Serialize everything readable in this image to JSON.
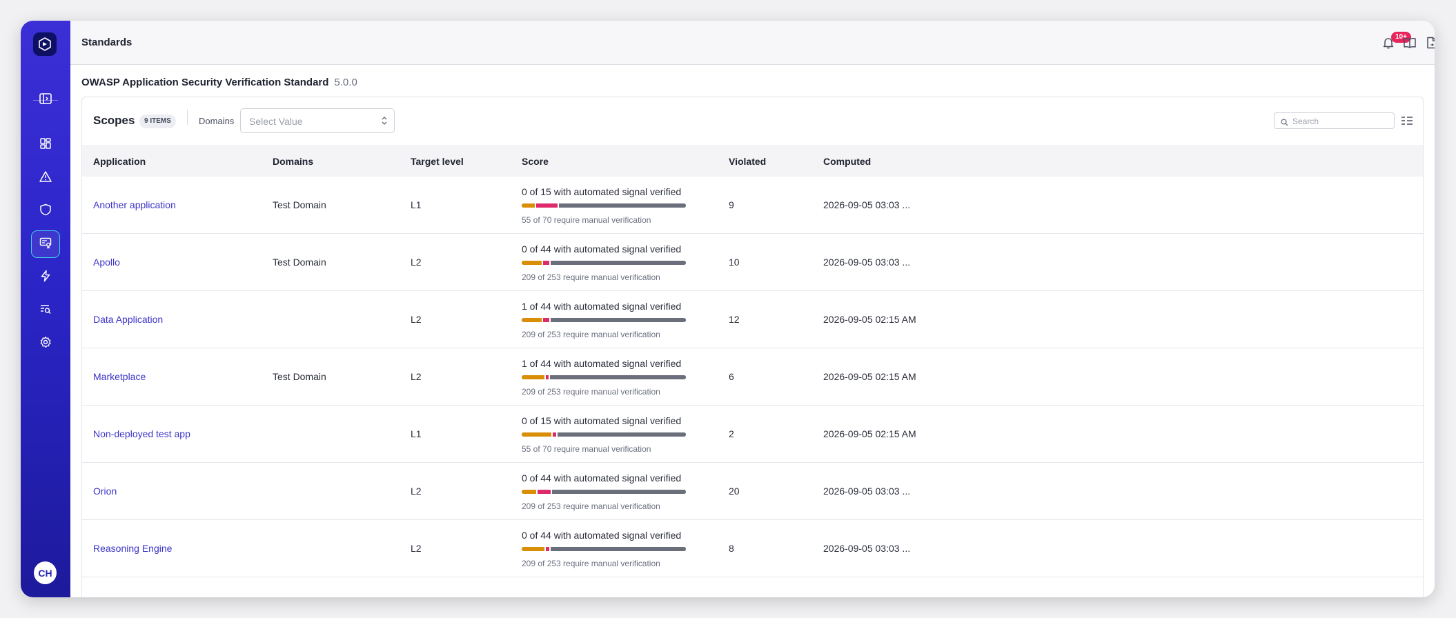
{
  "topbar": {
    "title": "Standards",
    "notification_count": "10+"
  },
  "standard": {
    "name": "OWASP Application Security Verification Standard",
    "version": "5.0.0"
  },
  "scopes": {
    "title": "Scopes",
    "count_label": "9 ITEMS",
    "domains_label": "Domains",
    "domains_placeholder": "Select Value",
    "search_placeholder": "Search"
  },
  "sidebar": {
    "avatar_initials": "CH"
  },
  "colors": {
    "sidebar_top": "#3b2fd6",
    "sidebar_bottom": "#1d1a9c",
    "link": "#3a33c9",
    "bar_automated": "#d98e08",
    "bar_violated": "#dd2a6a",
    "bar_manual": "#6b6f7c",
    "badge": "#e8245c",
    "active_outline": "#3fd0e4"
  },
  "table": {
    "headers": {
      "application": "Application",
      "domains": "Domains",
      "target": "Target level",
      "score": "Score",
      "violated": "Violated",
      "computed": "Computed"
    },
    "rows": [
      {
        "application": "Another application",
        "domains": "Test Domain",
        "target": "L1",
        "score": "0 of 15 with automated signal verified",
        "score_sub": "55 of 70 require manual verification",
        "violated": "9",
        "computed": "2026-09-05 03:03 ...",
        "bar": [
          0.08,
          0.13
        ]
      },
      {
        "application": "Apollo",
        "domains": "Test Domain",
        "target": "L2",
        "score": "0 of 44 with automated signal verified",
        "score_sub": "209 of 253 require manual verification",
        "violated": "10",
        "computed": "2026-09-05 03:03 ...",
        "bar": [
          0.12,
          0.04
        ]
      },
      {
        "application": "Data Application",
        "domains": "",
        "target": "L2",
        "score": "1 of 44 with automated signal verified",
        "score_sub": "209 of 253 require manual verification",
        "violated": "12",
        "computed": "2026-09-05 02:15 AM",
        "bar": [
          0.12,
          0.04
        ]
      },
      {
        "application": "Marketplace",
        "domains": "Test Domain",
        "target": "L2",
        "score": "1 of 44 with automated signal verified",
        "score_sub": "209 of 253 require manual verification",
        "violated": "6",
        "computed": "2026-09-05 02:15 AM",
        "bar": [
          0.14,
          0.015
        ]
      },
      {
        "application": "Non-deployed test app",
        "domains": "",
        "target": "L1",
        "score": "0 of 15 with automated signal verified",
        "score_sub": "55 of 70 require manual verification",
        "violated": "2",
        "computed": "2026-09-05 02:15 AM",
        "bar": [
          0.18,
          0.02
        ]
      },
      {
        "application": "Orion",
        "domains": "",
        "target": "L2",
        "score": "0 of 44 with automated signal verified",
        "score_sub": "209 of 253 require manual verification",
        "violated": "20",
        "computed": "2026-09-05 03:03 ...",
        "bar": [
          0.09,
          0.08
        ]
      },
      {
        "application": "Reasoning Engine",
        "domains": "",
        "target": "L2",
        "score": "0 of 44 with automated signal verified",
        "score_sub": "209 of 253 require manual verification",
        "violated": "8",
        "computed": "2026-09-05 03:03 ...",
        "bar": [
          0.14,
          0.02
        ]
      }
    ]
  }
}
